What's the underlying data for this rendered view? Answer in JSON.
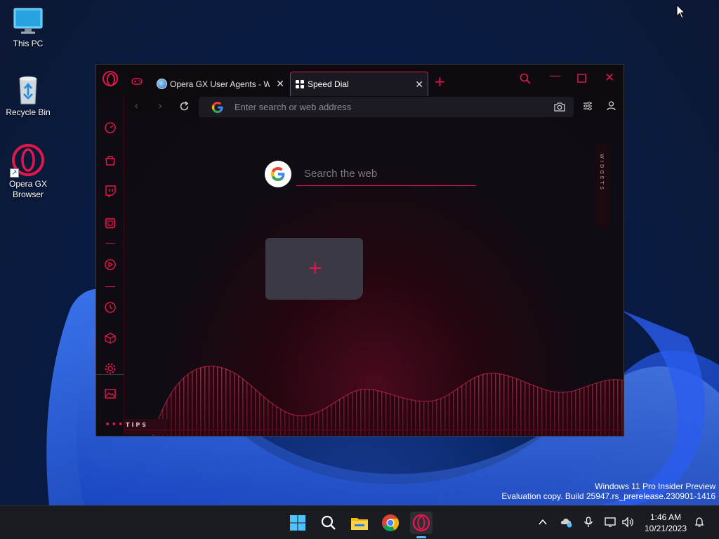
{
  "desktop": {
    "icons": [
      {
        "label": "This PC",
        "icon": "monitor-icon"
      },
      {
        "label": "Recycle Bin",
        "icon": "recycle-bin-icon"
      },
      {
        "label": "Opera GX\nBrowser",
        "icon": "opera-gx-icon"
      }
    ]
  },
  "browser": {
    "tabs": [
      {
        "title": "Opera GX User Agents - Wi",
        "icon": "globe-icon"
      },
      {
        "title": "Speed Dial",
        "icon": "grid-icon"
      }
    ],
    "address_placeholder": "Enter search or web address",
    "search_placeholder": "Search the web",
    "widgets_label": "WIDGETS",
    "tips_label": "TIPS",
    "accent_color": "#e0174b"
  },
  "sidebar_icons": [
    "speedometer-icon",
    "shopping-icon",
    "twitch-icon",
    "cpu-icon",
    "play-icon",
    "history-icon",
    "cube-icon",
    "settings-icon",
    "gallery-icon",
    "more-icon"
  ],
  "watermark": {
    "line1": "Windows 11 Pro Insider Preview",
    "line2": "Evaluation copy. Build 25947.rs_prerelease.230901-1416"
  },
  "taskbar": {
    "apps": [
      "windows-start-icon",
      "search-icon",
      "file-explorer-icon",
      "chrome-icon",
      "opera-gx-icon"
    ],
    "time": "1:46 AM",
    "date": "10/21/2023"
  }
}
